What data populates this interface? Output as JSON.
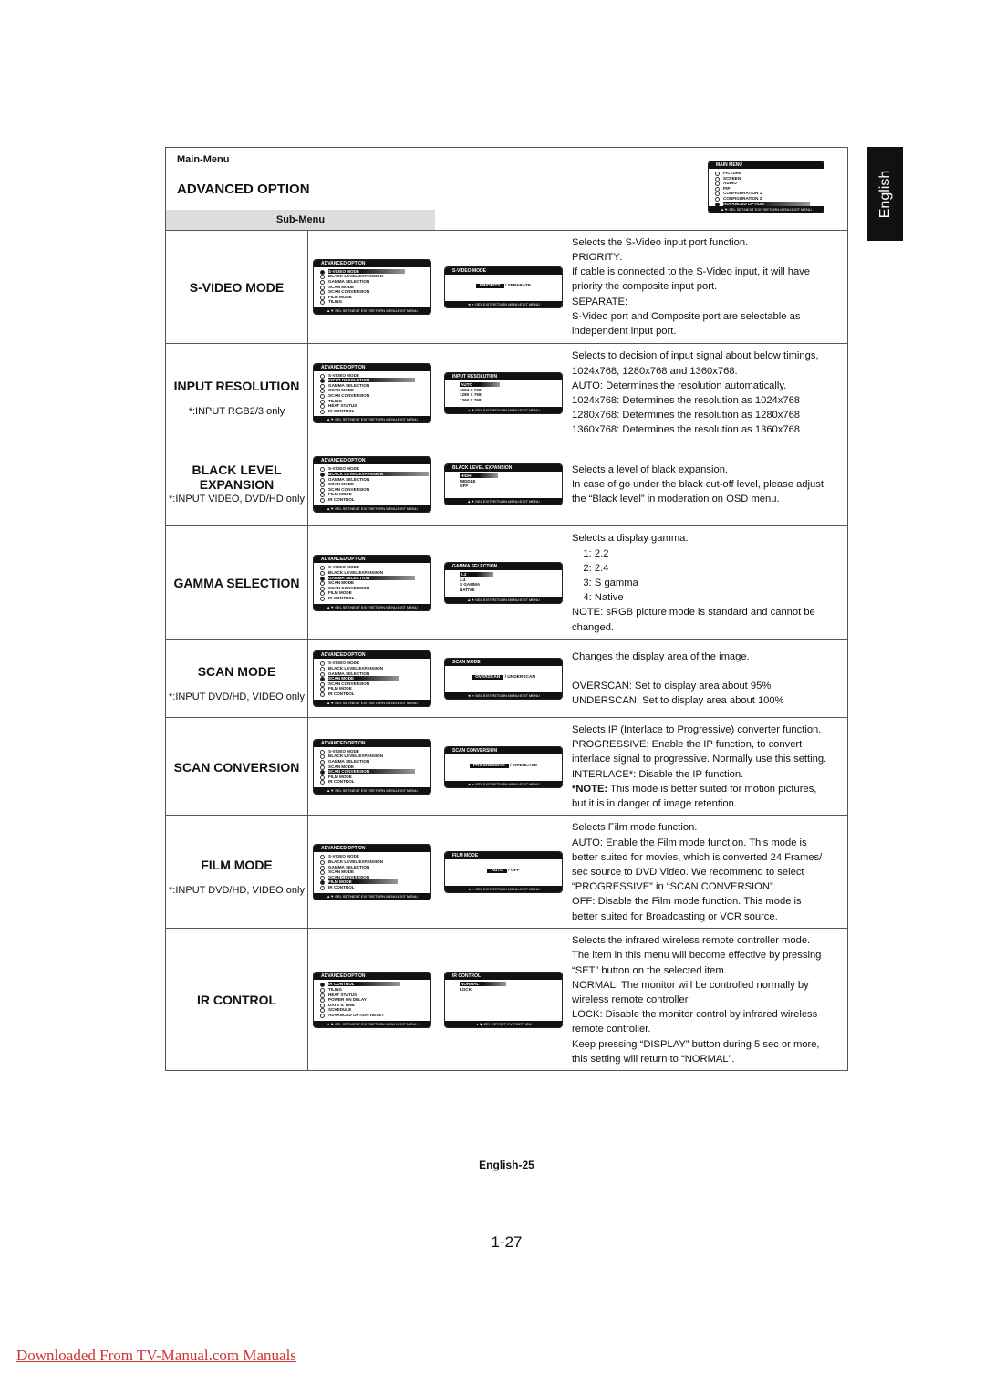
{
  "side_tab": "English",
  "header": {
    "main_menu_label": "Main-Menu",
    "title": "ADVANCED OPTION",
    "sub_menu_label": "Sub-Menu"
  },
  "main_osd": {
    "title": "MAIN MENU",
    "items": [
      "PICTURE",
      "SCREEN",
      "AUDIO",
      "PIP",
      "CONFIGURATION 1",
      "CONFIGURATION 2",
      "ADVANCED OPTION"
    ],
    "highlight": 6,
    "footer": "▲▼:SEL SET:NEXT EXIT:RETURN MENU:EXIT MENU"
  },
  "adv_footer": "▲▼:SEL SET:NEXT EXIT:RETURN MENU:EXIT MENU",
  "rows": [
    {
      "title": "S-VIDEO MODE",
      "note": "",
      "adv": {
        "title": "ADVANCED OPTION",
        "items": [
          "S-VIDEO MODE",
          "BLACK LEVEL EXPANSION",
          "GAMMA SELECTION",
          "SCAN MODE",
          "SCAN CONVERSION",
          "FILM MODE",
          "TILING"
        ],
        "highlight": 0
      },
      "sub": {
        "title": "S-VIDEO MODE",
        "type": "inline",
        "options": [
          "PRIORITY",
          "SEPARATE"
        ],
        "highlight": 0,
        "footer": "◄►:SEL EXIT:RETURN MENU:EXIT MENU"
      },
      "desc": [
        "Selects the S-Video input port function.",
        "PRIORITY:",
        "If cable is connected to the S-Video input, it will have",
        "priority the composite input port.",
        "SEPARATE:",
        "S-Video port and Composite port are selectable as",
        "independent input port."
      ]
    },
    {
      "title": "INPUT RESOLUTION",
      "note": "*:INPUT RGB2/3 only",
      "adv": {
        "title": "ADVANCED OPTION",
        "items": [
          "S-VIDEO MODE",
          "INPUT RESOLUTION",
          "GAMMA SELECTION",
          "SCAN MODE",
          "SCAN CONVERSION",
          "TILING",
          "HEAT STATUS",
          "IR CONTROL"
        ],
        "highlight": 1
      },
      "sub": {
        "title": "INPUT RESOLUTION",
        "type": "list",
        "options": [
          "AUTO",
          "1024 X 768",
          "1280 X 768",
          "1360 X 768"
        ],
        "highlight": 0,
        "footer": "▲▼:SEL EXIT:RETURN MENU:EXIT MENU"
      },
      "desc": [
        "Selects to decision of input signal about below timings,",
        "1024x768, 1280x768 and 1360x768.",
        "AUTO: Determines the resolution automatically.",
        "1024x768: Determines the resolution as 1024x768",
        "1280x768: Determines the resolution as 1280x768",
        "1360x768: Determines the resolution as 1360x768"
      ]
    },
    {
      "title": "BLACK LEVEL EXPANSION",
      "note": "*:INPUT VIDEO, DVD/HD only",
      "adv": {
        "title": "ADVANCED OPTION",
        "items": [
          "S-VIDEO MODE",
          "BLACK LEVEL EXPANSION",
          "GAMMA SELECTION",
          "SCAN MODE",
          "SCAN CONVERSION",
          "FILM MODE",
          "IR CONTROL"
        ],
        "highlight": 1
      },
      "sub": {
        "title": "BLACK LEVEL EXPANSION",
        "type": "list",
        "options": [
          "HIGH",
          "MIDDLE",
          "OFF"
        ],
        "highlight": 0,
        "footer": "▲▼:SEL EXIT:RETURN MENU:EXIT MENU"
      },
      "desc": [
        "Selects a level of black expansion.",
        "In case of go under the black cut-off level, please adjust",
        "the “Black level” in moderation on OSD menu."
      ]
    },
    {
      "title": "GAMMA SELECTION",
      "note": "",
      "adv": {
        "title": "ADVANCED OPTION",
        "items": [
          "S-VIDEO MODE",
          "BLACK LEVEL EXPANSION",
          "GAMMA SELECTION",
          "SCAN MODE",
          "SCAN CONVERSION",
          "FILM MODE",
          "IR CONTROL"
        ],
        "highlight": 2
      },
      "sub": {
        "title": "GAMMA SELECTION",
        "type": "list",
        "options": [
          "2.2",
          "2.4",
          "S GAMMA",
          "NATIVE"
        ],
        "highlight": 0,
        "footer": "▲▼:SEL EXIT:RETURN MENU:EXIT MENU"
      },
      "desc": [
        "Selects a display gamma.",
        "    1: 2.2",
        "    2: 2.4",
        "    3: S gamma",
        "    4: Native",
        "NOTE: sRGB picture mode is standard and cannot be",
        "changed."
      ]
    },
    {
      "title": "SCAN MODE",
      "note": "*:INPUT DVD/HD, VIDEO only",
      "adv": {
        "title": "ADVANCED OPTION",
        "items": [
          "S-VIDEO MODE",
          "BLACK LEVEL EXPANSION",
          "GAMMA SELECTION",
          "SCAN MODE",
          "SCAN CONVERSION",
          "FILM MODE",
          "IR CONTROL"
        ],
        "highlight": 3
      },
      "sub": {
        "title": "SCAN MODE",
        "type": "inline",
        "options": [
          "OVERSCAN",
          "UNDERSCAN"
        ],
        "highlight": 0,
        "footer": "◄►:SEL EXIT:RETURN MENU:EXIT MENU"
      },
      "desc": [
        "Changes the display area of the image.",
        "",
        "OVERSCAN: Set to display area about 95%",
        "UNDERSCAN: Set to display area about 100%"
      ]
    },
    {
      "title": "SCAN CONVERSION",
      "note": "",
      "adv": {
        "title": "ADVANCED OPTION",
        "items": [
          "S-VIDEO MODE",
          "BLACK LEVEL EXPANSION",
          "GAMMA SELECTION",
          "SCAN MODE",
          "SCAN CONVERSION",
          "FILM MODE",
          "IR CONTROL"
        ],
        "highlight": 4
      },
      "sub": {
        "title": "SCAN CONVERSION",
        "type": "inline",
        "options": [
          "PROGRESSIVE",
          "INTERLACE"
        ],
        "highlight": 0,
        "footer": "◄►:SEL EXIT:RETURN MENU:EXIT MENU"
      },
      "desc": [
        "Selects IP (Interlace to Progressive) converter function.",
        "PROGRESSIVE: Enable the IP function, to convert",
        "interlace signal to progressive. Normally use this setting.",
        "INTERLACE*: Disable the IP function.",
        "*NOTE: This mode is better suited for motion pictures,",
        "but it is in danger of image retention."
      ]
    },
    {
      "title": "FILM MODE",
      "note": "*:INPUT DVD/HD, VIDEO only",
      "adv": {
        "title": "ADVANCED OPTION",
        "items": [
          "S-VIDEO MODE",
          "BLACK LEVEL EXPANSION",
          "GAMMA SELECTION",
          "SCAN MODE",
          "SCAN CONVERSION",
          "FILM MODE",
          "IR CONTROL"
        ],
        "highlight": 5
      },
      "sub": {
        "title": "FILM MODE",
        "type": "inline",
        "options": [
          "AUTO",
          "OFF"
        ],
        "highlight": 0,
        "footer": "◄►:SEL EXIT:RETURN MENU:EXIT MENU"
      },
      "desc": [
        "Selects Film mode function.",
        "AUTO: Enable the Film mode function. This mode is",
        "better suited for movies, which is converted 24 Frames/",
        "sec source to DVD Video. We recommend to select",
        "“PROGRESSIVE” in “SCAN CONVERSION”.",
        "OFF: Disable the Film mode function. This mode is",
        "better suited for Broadcasting or VCR source."
      ]
    },
    {
      "title": "IR CONTROL",
      "note": "",
      "adv": {
        "title": "ADVANCED OPTION",
        "items": [
          "IR CONTROL",
          "TILING",
          "HEAT STATUS",
          "POWER ON DELAY",
          "DATE & TIME",
          "SCHEDULE",
          "ADVANCED OPTION RESET"
        ],
        "highlight": 0
      },
      "sub": {
        "title": "IR CONTROL",
        "type": "list",
        "options": [
          "NORMAL",
          "LOCK"
        ],
        "highlight": 0,
        "footer": "▲▼:SEL SET:SET EXIT:RETURN"
      },
      "desc": [
        "Selects the infrared wireless remote controller mode.",
        "The item in this menu will become effective by pressing",
        "“SET” button on the selected item.",
        "NORMAL: The monitor will be controlled normally by",
        "wireless remote controller.",
        "LOCK: Disable the monitor control by infrared wireless",
        "remote controller.",
        "Keep pressing “DISPLAY” button during 5 sec or more,",
        "this setting will return to “NORMAL”."
      ]
    }
  ],
  "page_number": "English-25",
  "page_number_alt": "1-27",
  "download_link": "Downloaded From TV-Manual.com Manuals"
}
